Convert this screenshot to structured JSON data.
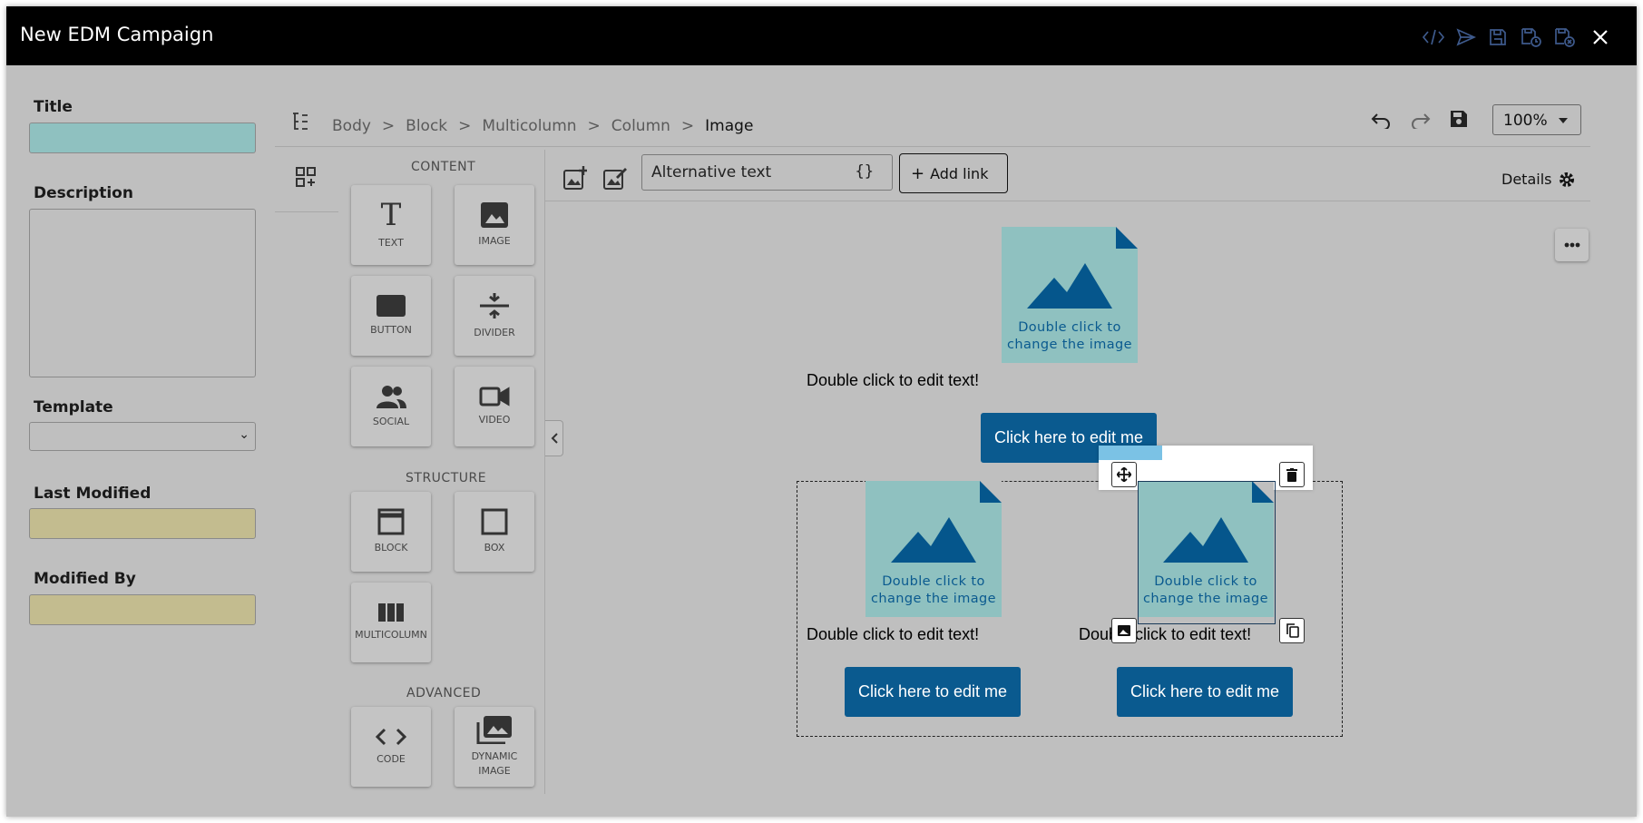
{
  "window": {
    "title": "New EDM Campaign"
  },
  "titlebar_icons": [
    "code-icon",
    "send-icon",
    "save-icon",
    "save-schedule-icon",
    "save-close-icon",
    "close-icon"
  ],
  "sidebar": {
    "title_label": "Title",
    "description_label": "Description",
    "template_label": "Template",
    "last_modified_label": "Last Modified",
    "modified_by_label": "Modified By"
  },
  "breadcrumb": {
    "items": [
      "Body",
      "Block",
      "Multicolumn",
      "Column",
      "Image"
    ],
    "separator": ">"
  },
  "toolbar": {
    "zoom": "100%",
    "details_label": "Details"
  },
  "palette": {
    "content_header": "CONTENT",
    "structure_header": "STRUCTURE",
    "advanced_header": "ADVANCED",
    "tiles": {
      "text": "TEXT",
      "image": "IMAGE",
      "button": "BUTTON",
      "divider": "DIVIDER",
      "social": "SOCIAL",
      "video": "VIDEO",
      "block": "BLOCK",
      "box": "BOX",
      "multicolumn": "MULTICOLUMN",
      "code": "CODE",
      "dynamic_image": "DYNAMIC IMAGE"
    }
  },
  "image_toolbar": {
    "alt_placeholder": "Alternative text",
    "alt_var": "{}",
    "add_link_label": "Add link"
  },
  "canvas": {
    "image_caption": "Double click to change the image",
    "edit_text": "Double click to edit text!",
    "button_label": "Click here to edit me"
  },
  "colors": {
    "titlebar": "#000000",
    "overlay": "#bfbfbf",
    "title_field": "#8fc1c0",
    "readonly_field": "#c3bc8f",
    "brand_blue": "#0a5a8f",
    "selected_blue": "#0e8fd0"
  }
}
